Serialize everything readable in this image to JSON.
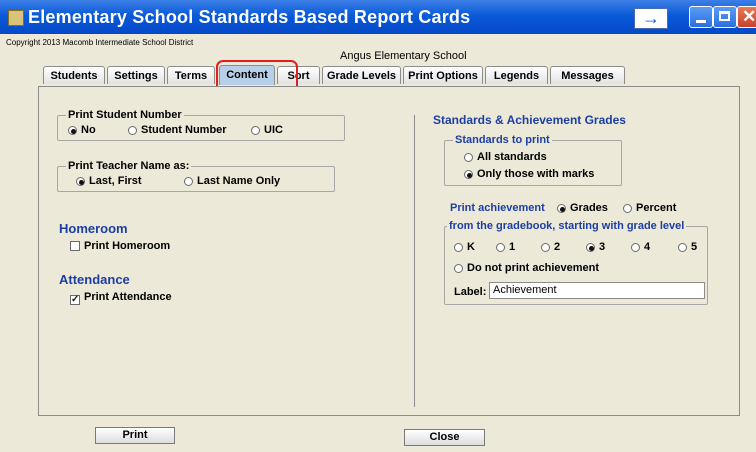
{
  "window": {
    "title": "Elementary School Standards Based Report Cards",
    "copyright": "Copyright 2013 Macomb Intermediate School District",
    "school": "Angus Elementary School",
    "arrow_glyph": "→"
  },
  "tabs": [
    {
      "label": "Students"
    },
    {
      "label": "Settings"
    },
    {
      "label": "Terms"
    },
    {
      "label": "Content",
      "active": true
    },
    {
      "label": "Sort"
    },
    {
      "label": "Grade Levels"
    },
    {
      "label": "Print Options"
    },
    {
      "label": "Legends"
    },
    {
      "label": "Messages"
    }
  ],
  "left": {
    "student_number": {
      "title": "Print Student Number",
      "options": [
        "No",
        "Student Number",
        "UIC"
      ],
      "selected": "No"
    },
    "teacher_name": {
      "title": "Print Teacher Name as:",
      "options": [
        "Last, First",
        "Last Name Only"
      ],
      "selected": "Last, First"
    },
    "homeroom": {
      "heading": "Homeroom",
      "checkbox_label": "Print Homeroom",
      "checked": false
    },
    "attendance": {
      "heading": "Attendance",
      "checkbox_label": "Print Attendance",
      "checked": true
    }
  },
  "right": {
    "heading": "Standards & Achievement Grades",
    "standards_to_print": {
      "title": "Standards to print",
      "options": [
        "All standards",
        "Only those with marks"
      ],
      "selected": "Only those with marks"
    },
    "print_achievement": {
      "label": "Print achievement",
      "options": [
        "Grades",
        "Percent"
      ],
      "selected": "Grades"
    },
    "grade_level": {
      "title": "from the gradebook, starting with grade level",
      "options": [
        "K",
        "1",
        "2",
        "3",
        "4",
        "5"
      ],
      "selected": "3",
      "none_option": "Do not print achievement"
    },
    "label_field": {
      "label": "Label:",
      "value": "Achievement"
    }
  },
  "buttons": {
    "print": "Print",
    "close": "Close"
  },
  "colors": {
    "titlebar": "#0a5ad8",
    "section_blue": "#1c3ea5",
    "highlight": "#e02020",
    "active_tab": "#b8cfe9"
  }
}
